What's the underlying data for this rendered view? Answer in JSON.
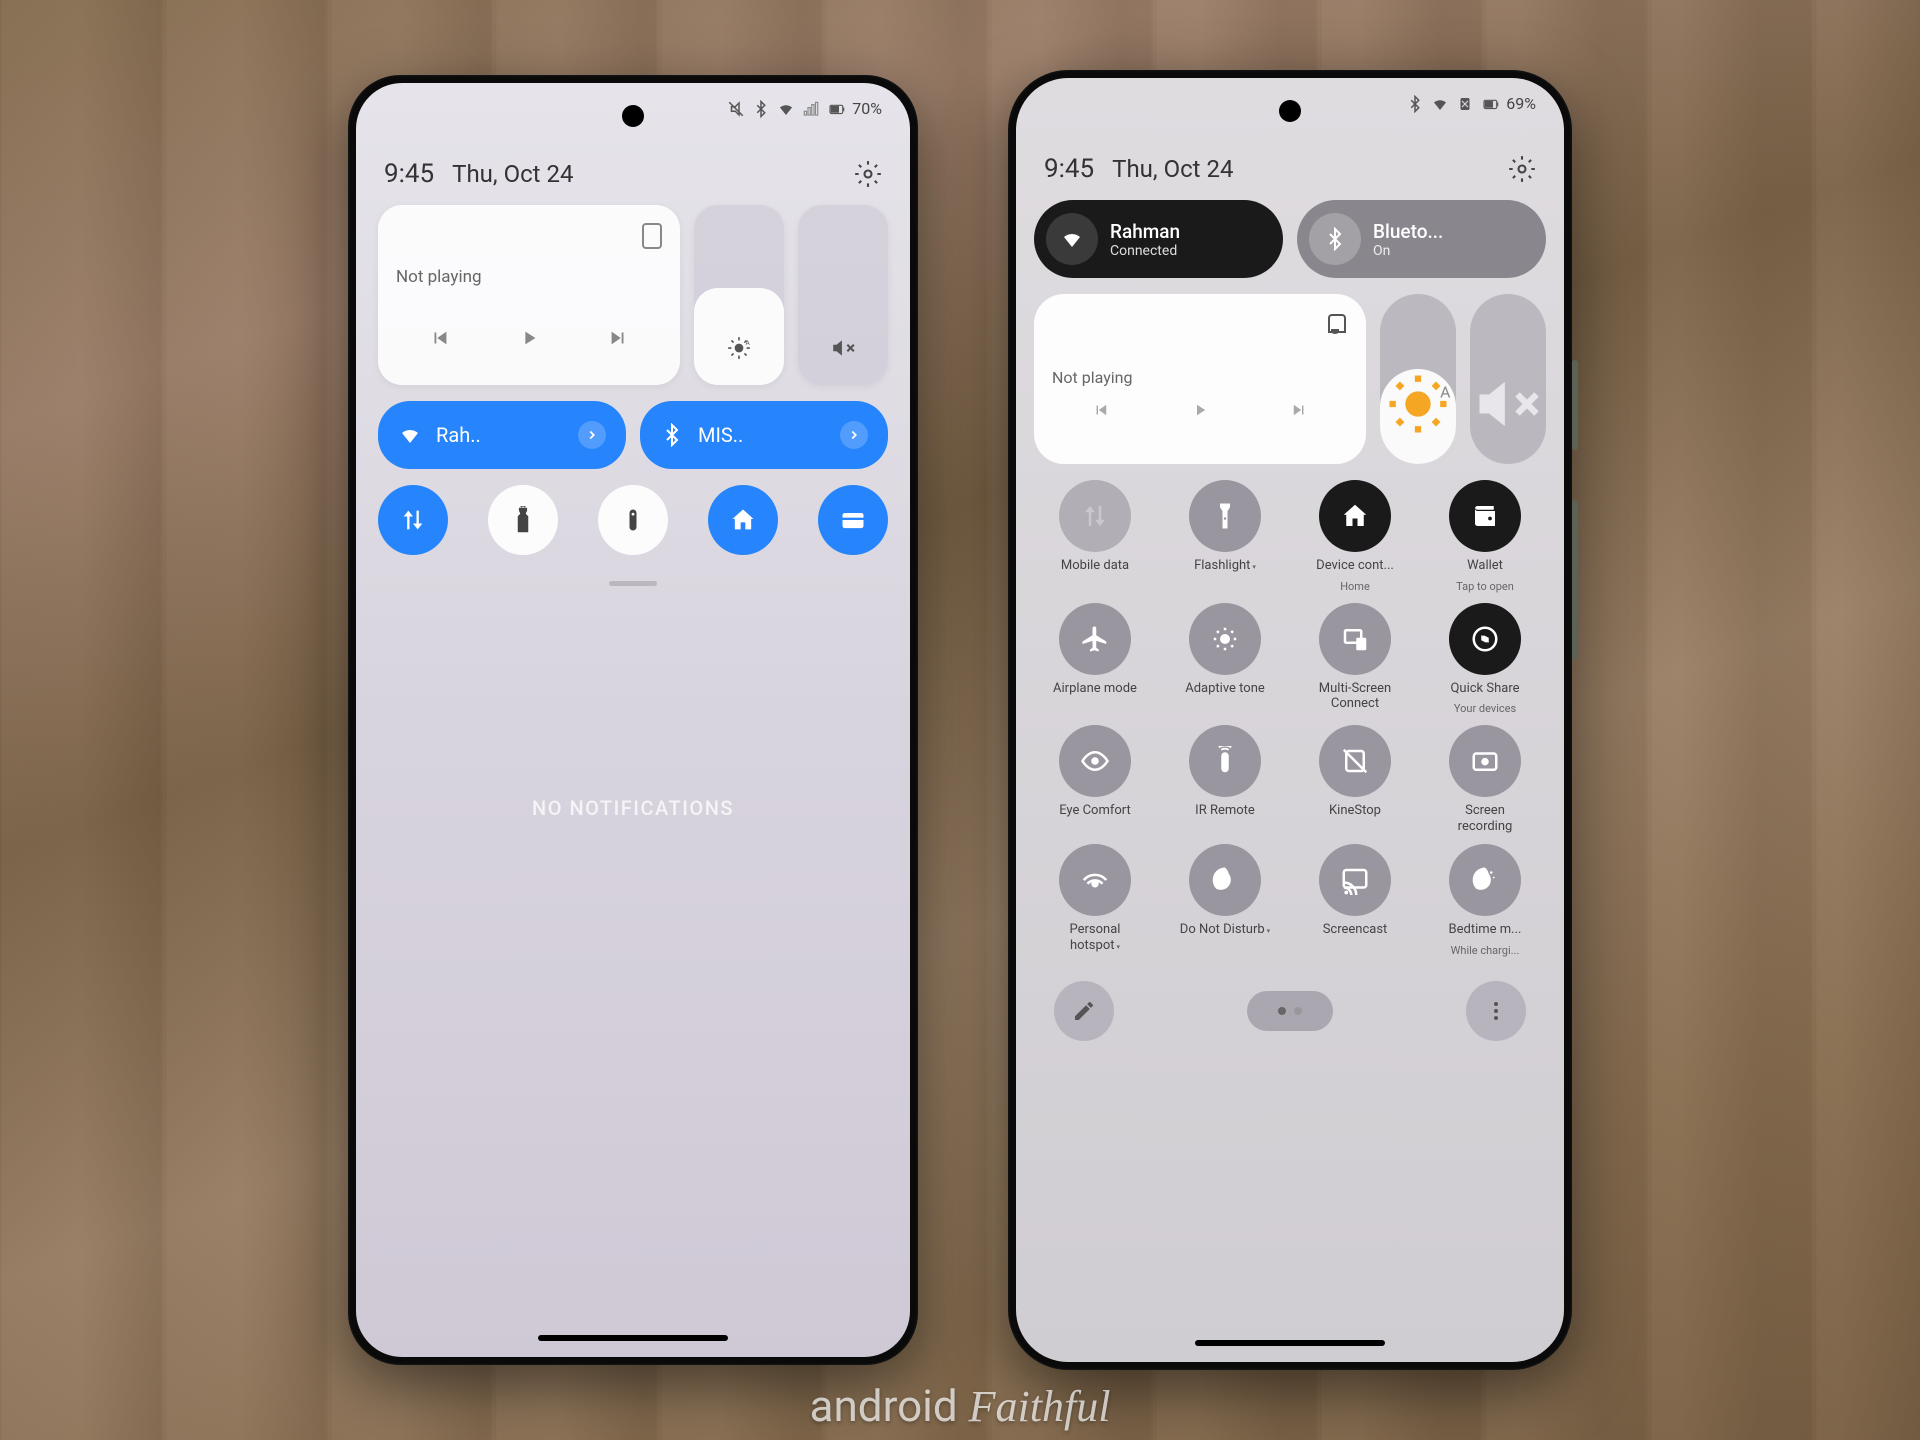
{
  "phone1": {
    "time": "9:45",
    "date": "Thu, Oct 24",
    "battery": "70%",
    "media": {
      "title": "Not playing"
    },
    "wifi": {
      "label": "Rah.."
    },
    "bt": {
      "label": "MIS.."
    },
    "no_notifications": "NO NOTIFICATIONS"
  },
  "phone2": {
    "time": "9:45",
    "date": "Thu, Oct 24",
    "battery": "69%",
    "wifi": {
      "name": "Rahman",
      "status": "Connected"
    },
    "bt": {
      "name": "Blueto...",
      "status": "On"
    },
    "media": {
      "title": "Not playing"
    },
    "tiles": [
      {
        "label": "Mobile data",
        "sub": "",
        "state": "dim"
      },
      {
        "label": "Flashlight",
        "sub": "",
        "state": "off",
        "arrow": true
      },
      {
        "label": "Device cont...",
        "sub": "Home",
        "state": "on"
      },
      {
        "label": "Wallet",
        "sub": "Tap to open",
        "state": "on"
      },
      {
        "label": "Airplane mode",
        "sub": "",
        "state": "off"
      },
      {
        "label": "Adaptive tone",
        "sub": "",
        "state": "off"
      },
      {
        "label": "Multi-Screen Connect",
        "sub": "",
        "state": "off"
      },
      {
        "label": "Quick Share",
        "sub": "Your devices",
        "state": "on"
      },
      {
        "label": "Eye Comfort",
        "sub": "",
        "state": "off"
      },
      {
        "label": "IR Remote",
        "sub": "",
        "state": "off"
      },
      {
        "label": "KineStop",
        "sub": "",
        "state": "off"
      },
      {
        "label": "Screen recording",
        "sub": "",
        "state": "off"
      },
      {
        "label": "Personal hotspot",
        "sub": "",
        "state": "off",
        "arrow": true
      },
      {
        "label": "Do Not Disturb",
        "sub": "",
        "state": "off",
        "arrow": true
      },
      {
        "label": "Screencast",
        "sub": "",
        "state": "off"
      },
      {
        "label": "Bedtime m...",
        "sub": "While chargi...",
        "state": "off"
      }
    ]
  },
  "watermark": {
    "a": "android",
    "b": "Faithful"
  }
}
